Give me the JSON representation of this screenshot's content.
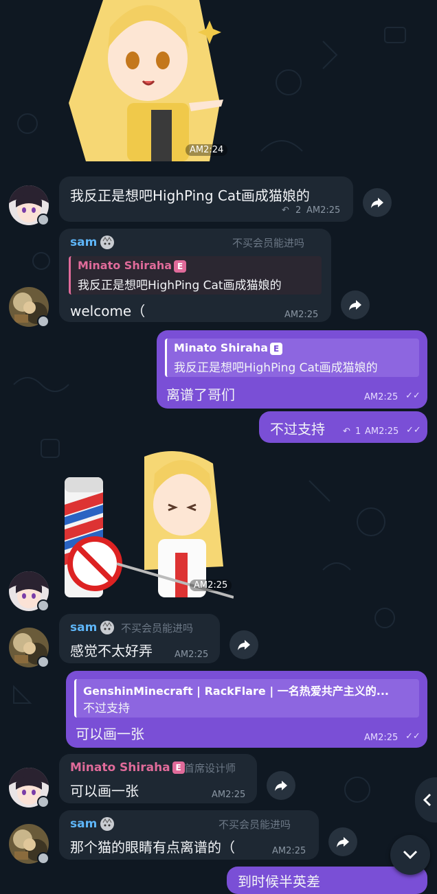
{
  "messages": {
    "m1": {
      "time": "AM2:24"
    },
    "m2": {
      "text": "我反正是想吧HighPing Cat画成猫娘的",
      "replies": "2",
      "time": "AM2:25"
    },
    "m3": {
      "sender": "sam",
      "title": "不买会员能进吗",
      "reply_name": "Minato Shiraha",
      "reply_text": "我反正是想吧HighPing Cat画成猫娘的",
      "text": "welcome（",
      "time": "AM2:25"
    },
    "m4": {
      "reply_name": "Minato Shiraha",
      "reply_text": "我反正是想吧HighPing Cat画成猫娘的",
      "text": "离谱了哥们",
      "time": "AM2:25"
    },
    "m5": {
      "text": "不过支持",
      "replies": "1",
      "time": "AM2:25"
    },
    "m6": {
      "time": "AM2:25"
    },
    "m7": {
      "sender": "sam",
      "title": "不买会员能进吗",
      "text": "感觉不太好弄",
      "time": "AM2:25"
    },
    "m8": {
      "reply_name": "GenshinMinecraft | RackFlare | 一名热爱共产主义的...",
      "reply_text": "不过支持",
      "text": "可以画一张",
      "time": "AM2:25"
    },
    "m9": {
      "sender": "Minato Shiraha",
      "title": "首席设计师",
      "text": "可以画一张",
      "time": "AM2:25"
    },
    "m10": {
      "sender": "sam",
      "title": "不买会员能进吗",
      "text": "那个猫的眼睛有点离谱的（",
      "time": "AM2:25"
    },
    "m11": {
      "text": "到时候半英差"
    }
  },
  "badge_letter": "E",
  "colors": {
    "background": "#0f1822",
    "incoming": "#1e2833",
    "outgoing": "#7a4fd6",
    "sender_blue": "#5eb5f7",
    "admin_pink": "#e06b9a"
  }
}
